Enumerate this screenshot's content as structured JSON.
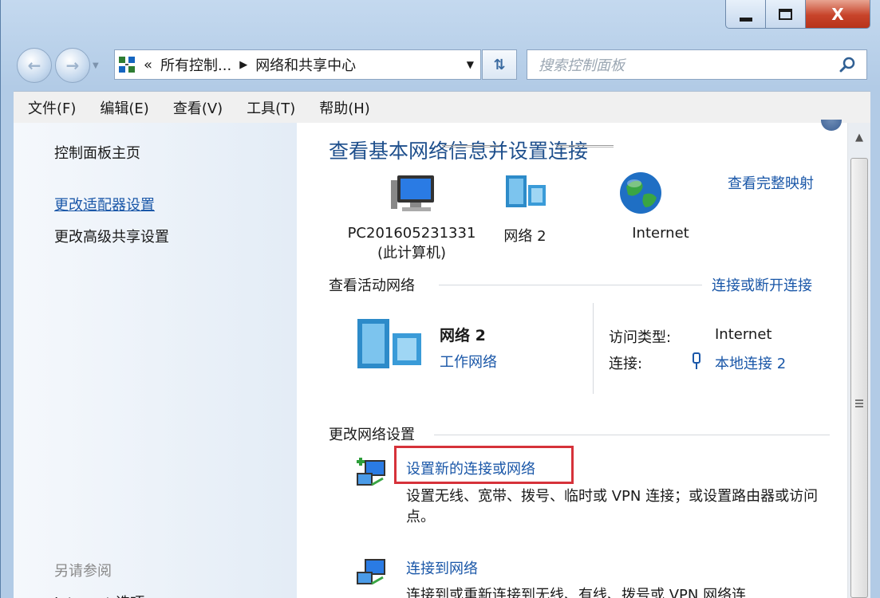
{
  "window": {
    "caption": {
      "minimize": "minimize",
      "maximize": "maximize",
      "close_glyph": "X"
    }
  },
  "nav": {
    "back_icon": "back-arrow-icon",
    "forward_icon": "forward-arrow-icon",
    "history_dropdown_icon": "chevron-down-icon"
  },
  "address": {
    "icon": "network-center-icon",
    "prefix": "«",
    "segments": [
      "所有控制...",
      "网络和共享中心"
    ],
    "separator": "▶",
    "dropdown_icon": "▼"
  },
  "refresh": {
    "icon": "refresh-arrows-icon"
  },
  "search": {
    "placeholder": "搜索控制面板",
    "icon": "search-icon"
  },
  "menu": {
    "items": [
      "文件(F)",
      "编辑(E)",
      "查看(V)",
      "工具(T)",
      "帮助(H)"
    ]
  },
  "sidebar": {
    "home": "控制面板主页",
    "adapter_settings": "更改适配器设置",
    "advanced_sharing": "更改高级共享设置",
    "see_also": "另请参阅",
    "internet_options": "Internet 选项"
  },
  "main": {
    "heading": "查看基本网络信息并设置连接",
    "view_full_map": "查看完整映射",
    "map": {
      "computer_name": "PC201605231331",
      "computer_sub": "(此计算机)",
      "network": "网络  2",
      "internet": "Internet"
    },
    "active_networks": {
      "title": "查看活动网络",
      "connect_link": "连接或断开连接",
      "network_name": "网络  2",
      "network_type": "工作网络",
      "access_type_label": "访问类型:",
      "access_type_value": "Internet",
      "connections_label": "连接:",
      "connections_value": "本地连接 2"
    },
    "change_settings": {
      "title": "更改网络设置",
      "tasks": [
        {
          "link": "设置新的连接或网络",
          "desc": "设置无线、宽带、拨号、临时或 VPN 连接；或设置路由器或访问点。"
        },
        {
          "link": "连接到网络",
          "desc": "连接到或重新连接到无线、有线、拨号或 VPN 网络连"
        }
      ]
    }
  },
  "colors": {
    "link": "#1a57a8",
    "heading": "#1e4f8c",
    "highlight": "#d6323a",
    "close": "#c7432a"
  }
}
